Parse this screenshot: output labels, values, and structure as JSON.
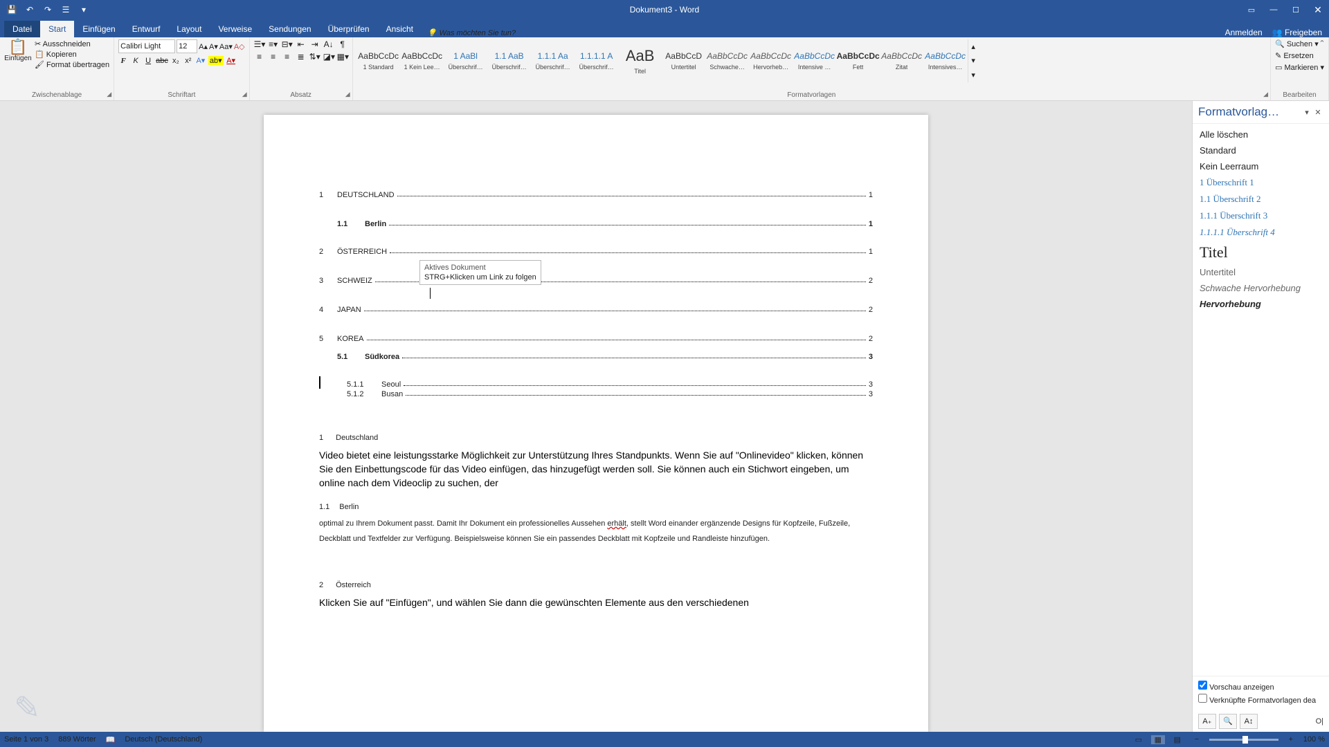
{
  "app": {
    "title": "Dokument3 - Word"
  },
  "qat": {
    "save": "💾",
    "undo": "↶",
    "redo": "↷",
    "touch": "☰",
    "more": "▾"
  },
  "win": {
    "opts": "▭",
    "min": "—",
    "max": "☐",
    "close": "✕"
  },
  "tabs": {
    "file": "Datei",
    "home": "Start",
    "insert": "Einfügen",
    "design": "Entwurf",
    "layout": "Layout",
    "references": "Verweise",
    "mailings": "Sendungen",
    "review": "Überprüfen",
    "view": "Ansicht",
    "tell": "Was möchten Sie tun?",
    "signin": "Anmelden",
    "share": "Freigeben"
  },
  "ribbon": {
    "clipboard": {
      "paste": "Einfügen",
      "cut": "Ausschneiden",
      "copy": "Kopieren",
      "fmt": "Format übertragen",
      "label": "Zwischenablage"
    },
    "font": {
      "name": "Calibri Light",
      "size": "12",
      "label": "Schriftart"
    },
    "para": {
      "label": "Absatz"
    },
    "styles": {
      "label": "Formatvorlagen",
      "items": [
        {
          "prev": "AaBbCcDc",
          "name": "1 Standard",
          "cls": ""
        },
        {
          "prev": "AaBbCcDc",
          "name": "1 Kein Lee…",
          "cls": ""
        },
        {
          "prev": "1   AaBl",
          "name": "Überschrif…",
          "cls": "h"
        },
        {
          "prev": "1.1   AaB",
          "name": "Überschrif…",
          "cls": "h"
        },
        {
          "prev": "1.1.1   Aa",
          "name": "Überschrif…",
          "cls": "h"
        },
        {
          "prev": "1.1.1.1  A",
          "name": "Überschrif…",
          "cls": "h"
        },
        {
          "prev": "AaB",
          "name": "Titel",
          "cls": "ttl"
        },
        {
          "prev": "AaBbCcD",
          "name": "Untertitel",
          "cls": ""
        },
        {
          "prev": "AaBbCcDc",
          "name": "Schwache…",
          "cls": "zit"
        },
        {
          "prev": "AaBbCcDc",
          "name": "Hervorheb…",
          "cls": "zit"
        },
        {
          "prev": "AaBbCcDc",
          "name": "Intensive …",
          "cls": "intz"
        },
        {
          "prev": "AaBbCcDc",
          "name": "Fett",
          "cls": "fett"
        },
        {
          "prev": "AaBbCcDc",
          "name": "Zitat",
          "cls": "zit"
        },
        {
          "prev": "AaBbCcDc",
          "name": "Intensives…",
          "cls": "intz"
        }
      ]
    },
    "editing": {
      "find": "Suchen ▾",
      "replace": "Ersetzen",
      "select": "Markieren ▾",
      "label": "Bearbeiten"
    }
  },
  "toc": [
    {
      "lvl": 1,
      "num": "1",
      "txt": "DEUTSCHLAND",
      "pg": "1",
      "cls": "sp"
    },
    {
      "lvl": 2,
      "num": "1.1",
      "txt": "Berlin",
      "pg": "1"
    },
    {
      "lvl": 1,
      "num": "2",
      "txt": "ÖSTERREICH",
      "pg": "1",
      "cls": "sp"
    },
    {
      "lvl": 1,
      "num": "3",
      "txt": "SCHWEIZ",
      "pg": "2",
      "cls": "sp"
    },
    {
      "lvl": 1,
      "num": "4",
      "txt": "JAPAN",
      "pg": "2",
      "cls": "sp"
    },
    {
      "lvl": 1,
      "num": "5",
      "txt": "KOREA",
      "pg": "2",
      "cls": ""
    },
    {
      "lvl": 2,
      "num": "5.1",
      "txt": "Südkorea",
      "pg": "3",
      "cls": ""
    },
    {
      "lvl": 3,
      "num": "5.1.1",
      "txt": "Seoul",
      "pg": "3"
    },
    {
      "lvl": 3,
      "num": "5.1.2",
      "txt": "Busan",
      "pg": "3"
    }
  ],
  "tooltip": {
    "l1": "Aktives Dokument",
    "l2": "STRG+Klicken um Link zu folgen"
  },
  "doc": {
    "h1a_num": "1",
    "h1a": "Deutschland",
    "p1": "Video bietet eine leistungsstarke Möglichkeit zur Unterstützung Ihres Standpunkts. Wenn Sie auf \"Onlinevideo\" klicken, können Sie den Einbettungscode für das Video einfügen, das hinzugefügt werden soll. Sie können auch ein Stichwort eingeben, um online nach dem Videoclip zu suchen, der",
    "h2a_num": "1.1",
    "h2a": "Berlin",
    "p2a": "optimal zu Ihrem Dokument passt. Damit Ihr Dokument ein professionelles Aussehen ",
    "p2u": "erhält",
    "p2b": ", stellt Word einander ergänzende Designs für Kopfzeile, Fußzeile, Deckblatt und Textfelder zur Verfügung. Beispielsweise können Sie ein passendes Deckblatt mit Kopfzeile und Randleiste hinzufügen.",
    "h1b_num": "2",
    "h1b": "Österreich",
    "p3": "Klicken Sie auf \"Einfügen\", und wählen Sie dann die gewünschten Elemente aus den verschiedenen"
  },
  "stylepane": {
    "title": "Formatvorlag…",
    "clear": "Alle löschen",
    "items": [
      {
        "t": "Standard",
        "cls": ""
      },
      {
        "t": "Kein Leerraum",
        "cls": ""
      },
      {
        "t": "1  Überschrift 1",
        "cls": "h"
      },
      {
        "t": "1.1  Überschrift 2",
        "cls": "h"
      },
      {
        "t": "1.1.1  Überschrift 3",
        "cls": "h"
      },
      {
        "t": "1.1.1.1  Überschrift 4",
        "cls": "h h4"
      },
      {
        "t": "Titel",
        "cls": "titel"
      },
      {
        "t": "Untertitel",
        "cls": "sub"
      },
      {
        "t": "Schwache Hervorhebung",
        "cls": "sch"
      },
      {
        "t": "Hervorhebung",
        "cls": "hv"
      }
    ],
    "preview": "Vorschau anzeigen",
    "linked": "Verknüpfte Formatvorlagen dea",
    "opt": "O|"
  },
  "status": {
    "page": "Seite 1 von 3",
    "words": "889 Wörter",
    "lang": "Deutsch (Deutschland)",
    "zoom": "100 %"
  }
}
